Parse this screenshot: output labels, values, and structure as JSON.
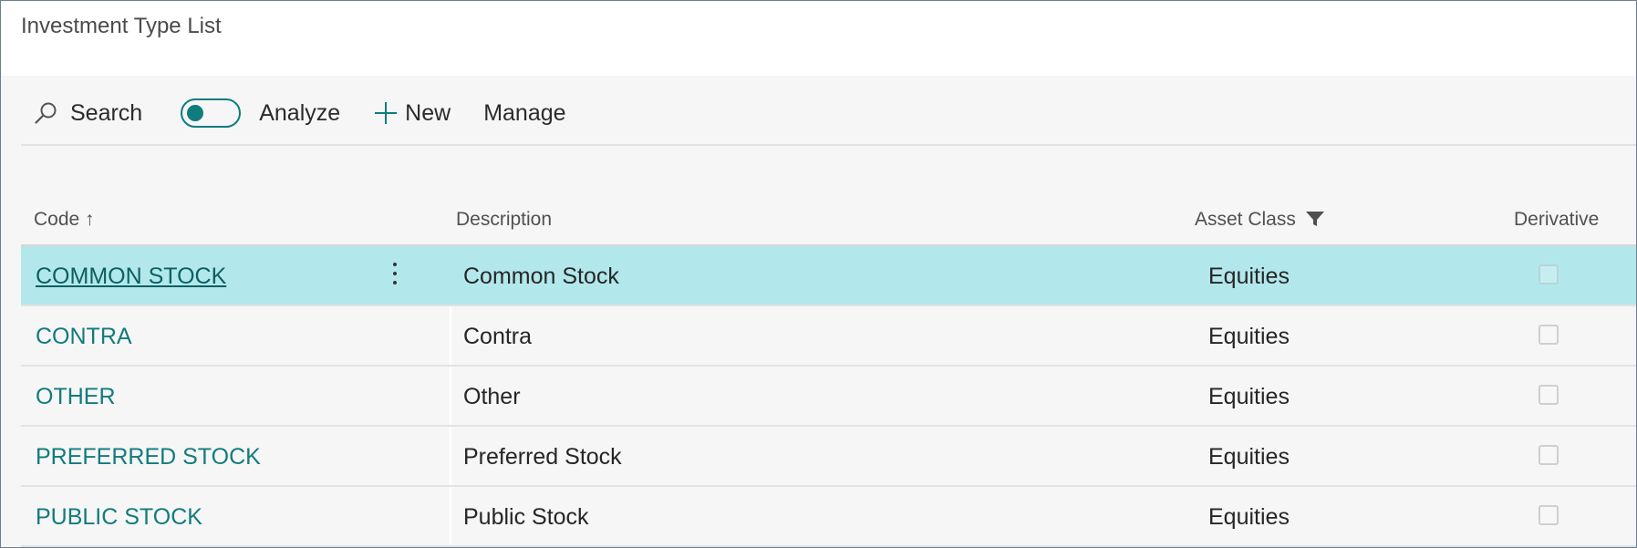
{
  "window": {
    "title": "Investment Type List"
  },
  "toolbar": {
    "search_label": "Search",
    "analyze_label": "Analyze",
    "new_label": "New",
    "manage_label": "Manage"
  },
  "table": {
    "columns": {
      "code": "Code ↑",
      "description": "Description",
      "asset_class": "Asset Class",
      "derivative": "Derivative"
    },
    "rows": [
      {
        "code": "COMMON STOCK",
        "description": "Common Stock",
        "asset_class": "Equities",
        "derivative": false,
        "selected": true
      },
      {
        "code": "CONTRA",
        "description": "Contra",
        "asset_class": "Equities",
        "derivative": false,
        "selected": false
      },
      {
        "code": "OTHER",
        "description": "Other",
        "asset_class": "Equities",
        "derivative": false,
        "selected": false
      },
      {
        "code": "PREFERRED STOCK",
        "description": "Preferred Stock",
        "asset_class": "Equities",
        "derivative": false,
        "selected": false
      },
      {
        "code": "PUBLIC STOCK",
        "description": "Public Stock",
        "asset_class": "Equities",
        "derivative": false,
        "selected": false
      }
    ]
  },
  "colors": {
    "accent": "#0f7c7f",
    "selected_row": "#b2e8ec",
    "link": "#127b7d"
  },
  "icons": {
    "search": "search-icon",
    "analyze_toggle": "toggle-icon",
    "new": "plus-icon",
    "sort": "arrow-up-icon",
    "filter": "filter-icon",
    "row_actions": "more-vertical-icon"
  }
}
